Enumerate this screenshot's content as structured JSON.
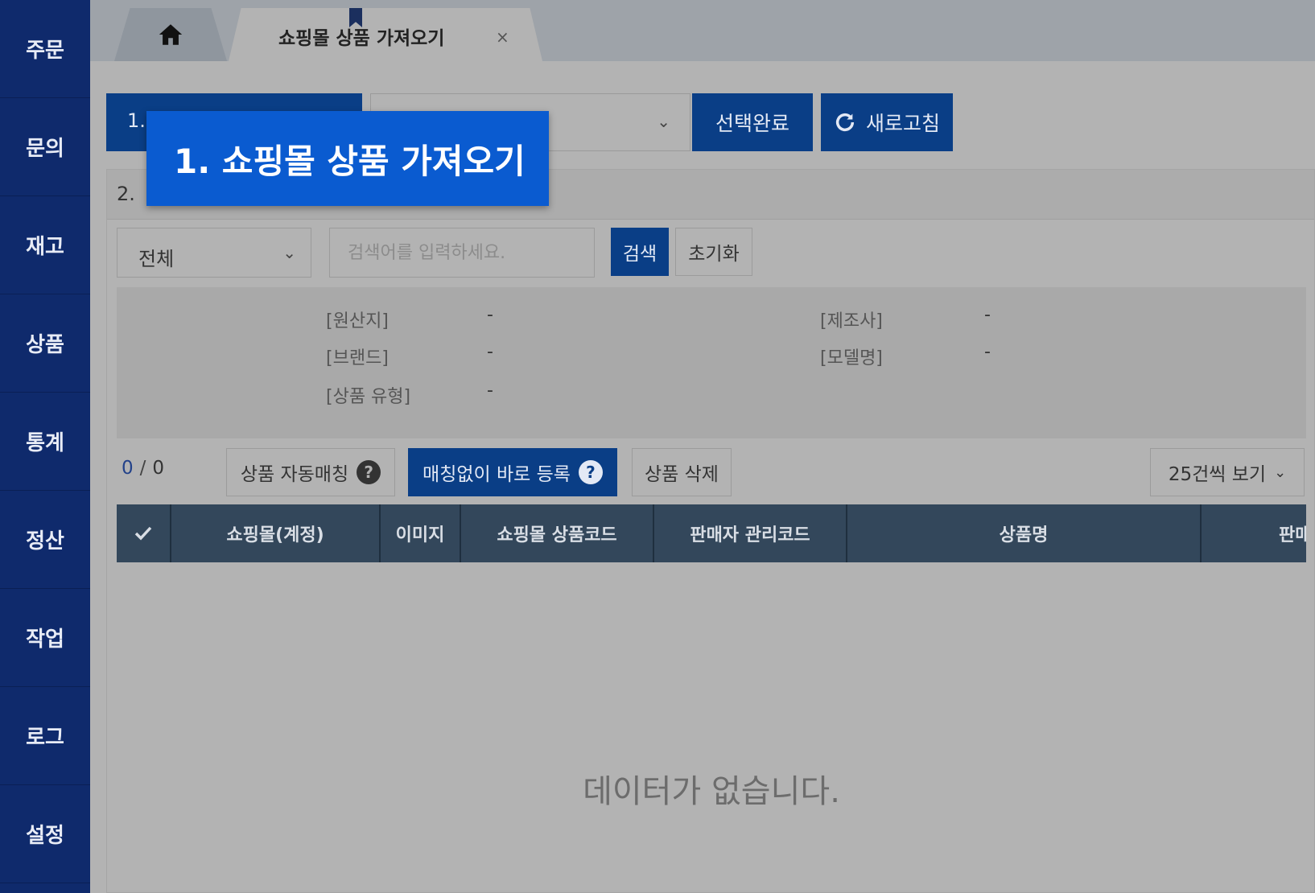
{
  "sidebar": {
    "items": [
      {
        "label": "주문"
      },
      {
        "label": "문의"
      },
      {
        "label": "재고"
      },
      {
        "label": "상품"
      },
      {
        "label": "통계"
      },
      {
        "label": "정산"
      },
      {
        "label": "작업"
      },
      {
        "label": "로그"
      },
      {
        "label": "설정"
      }
    ]
  },
  "tabs": {
    "home_icon": "home-icon",
    "active_label": "쇼핑몰 상품 가져오기",
    "close_label": "×"
  },
  "step1": {
    "label": "1.",
    "select_value": "",
    "confirm_label": "선택완료",
    "refresh_label": "새로고침"
  },
  "tooltip": {
    "text": "1. 쇼핑몰 상품 가져오기"
  },
  "step2": {
    "label": "2.",
    "filter_value": "전체",
    "search_placeholder": "검색어를 입력하세요.",
    "search_label": "검색",
    "reset_label": "초기화"
  },
  "info": {
    "origin_label": "[원산지]",
    "origin_value": "-",
    "manufacturer_label": "[제조사]",
    "manufacturer_value": "-",
    "brand_label": "[브랜드]",
    "brand_value": "-",
    "model_label": "[모델명]",
    "model_value": "-",
    "type_label": "[상품 유형]",
    "type_value": "-"
  },
  "toolbar": {
    "selected_count": "0",
    "separator": "/",
    "total_count": "0",
    "auto_match_label": "상품 자동매칭",
    "direct_register_label": "매칭없이 바로 등록",
    "delete_label": "상품 삭제",
    "page_size_label": "25건씩 보기"
  },
  "table": {
    "columns": [
      "쇼핑몰(계정)",
      "이미지",
      "쇼핑몰 상품코드",
      "판매자 관리코드",
      "상품명",
      "판매가"
    ],
    "empty_message": "데이터가 없습니다."
  },
  "colors": {
    "sidebar": "#0f2a6c",
    "primary_button": "#0a3e86",
    "tooltip": "#0a5bd0",
    "table_header": "#33475b"
  }
}
